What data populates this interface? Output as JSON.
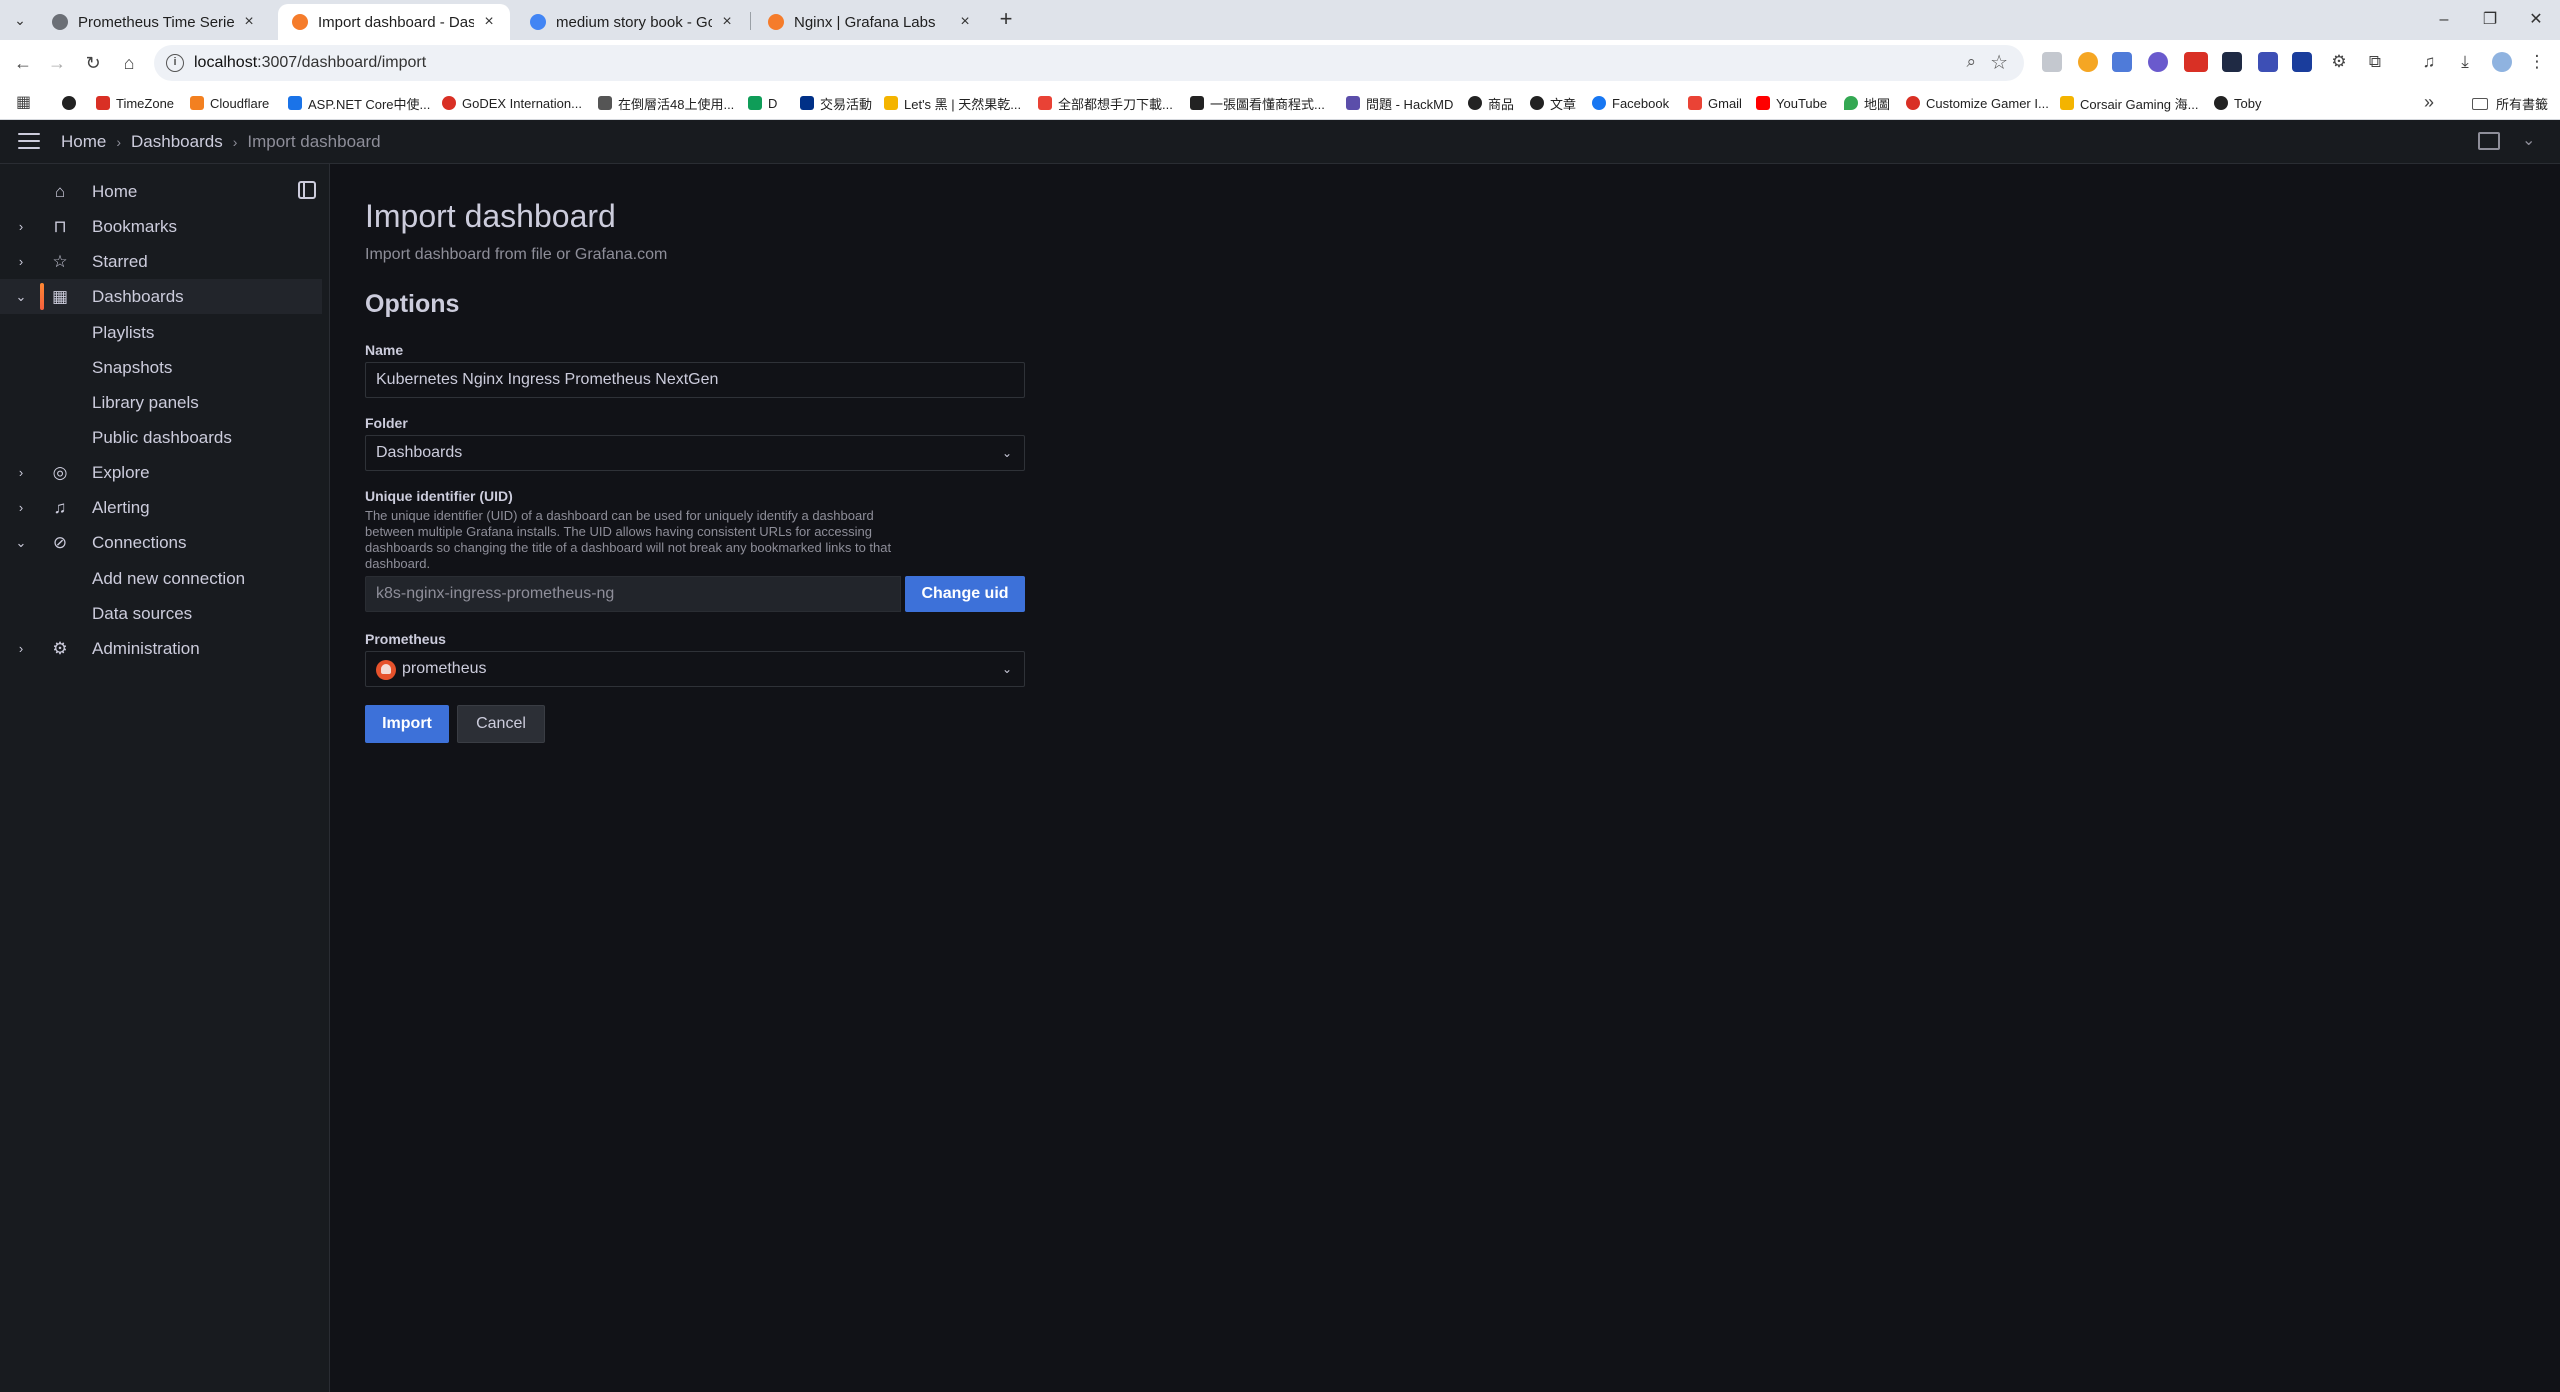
{
  "browser": {
    "tabs": [
      {
        "title": "Prometheus Time Series Colle",
        "color": "#6b6f76"
      },
      {
        "title": "Import dashboard - Dashboa",
        "color": "#f57c2b"
      },
      {
        "title": "medium story book - Google",
        "color": "#4285f4"
      },
      {
        "title": "Nginx | Grafana Labs",
        "color": "#f57c2b"
      }
    ],
    "url_host": "localhost",
    "url_path": ":3007/dashboard/import",
    "bookmarks": [
      {
        "label": "",
        "color": "#222222"
      },
      {
        "label": "TimeZone",
        "color": "#d93025"
      },
      {
        "label": "Cloudflare",
        "color": "#f38020"
      },
      {
        "label": "ASP.NET Core中使...",
        "color": "#1a73e8"
      },
      {
        "label": "GoDEX Internation...",
        "color": "#d93025"
      },
      {
        "label": "在倒層活48上使用...",
        "color": "#555555"
      },
      {
        "label": "D",
        "color": "#0f9d58"
      },
      {
        "label": "交易活動",
        "color": "#003087"
      },
      {
        "label": "Let's 黑 | 天然果乾...",
        "color": "#f4b400"
      },
      {
        "label": "全部都想手刀下載...",
        "color": "#e94235"
      },
      {
        "label": "一張圖看懂商程式...",
        "color": "#222222"
      },
      {
        "label": "問題 - HackMD",
        "color": "#5b4eaa"
      },
      {
        "label": "商品",
        "color": "#222222"
      },
      {
        "label": "文章",
        "color": "#222222"
      },
      {
        "label": "Facebook",
        "color": "#1877f2"
      },
      {
        "label": "Gmail",
        "color": "#ea4335"
      },
      {
        "label": "YouTube",
        "color": "#ff0000"
      },
      {
        "label": "地圖",
        "color": "#34a853"
      },
      {
        "label": "Customize Gamer I...",
        "color": "#d93025"
      },
      {
        "label": "Corsair Gaming 海...",
        "color": "#f4b400"
      },
      {
        "label": "Toby",
        "color": "#222222"
      }
    ],
    "bookmarks_folder": "所有書籤"
  },
  "topnav": {
    "crumbs": [
      "Home",
      "Dashboards",
      "Import dashboard"
    ]
  },
  "sidebar": {
    "items": [
      {
        "label": "Home",
        "icon": "home-icon",
        "glyph": "⌂",
        "chevron": ""
      },
      {
        "label": "Bookmarks",
        "icon": "bookmark-icon",
        "glyph": "🔖",
        "chevron": "›"
      },
      {
        "label": "Starred",
        "icon": "star-icon",
        "glyph": "☆",
        "chevron": "›"
      },
      {
        "label": "Dashboards",
        "icon": "apps-icon",
        "glyph": "▦",
        "chevron": "⌄"
      },
      {
        "label": "Explore",
        "icon": "compass-icon",
        "glyph": "◎",
        "chevron": "›"
      },
      {
        "label": "Alerting",
        "icon": "bell-icon",
        "glyph": "🔔",
        "chevron": "›"
      },
      {
        "label": "Connections",
        "icon": "connections-icon",
        "glyph": "⊘",
        "chevron": "⌄"
      },
      {
        "label": "Administration",
        "icon": "cog-icon",
        "glyph": "⚙",
        "chevron": "›"
      }
    ],
    "dashboards_sub": [
      "Playlists",
      "Snapshots",
      "Library panels",
      "Public dashboards"
    ],
    "connections_sub": [
      "Add new connection",
      "Data sources"
    ]
  },
  "main": {
    "title": "Import dashboard",
    "subtitle": "Import dashboard from file or Grafana.com",
    "section": "Options",
    "name_label": "Name",
    "name_value": "Kubernetes Nginx Ingress Prometheus NextGen",
    "folder_label": "Folder",
    "folder_value": "Dashboards",
    "uid_label": "Unique identifier (UID)",
    "uid_description": "The unique identifier (UID) of a dashboard can be used for uniquely identify a dashboard between multiple Grafana installs. The UID allows having consistent URLs for accessing dashboards so changing the title of a dashboard will not break any bookmarked links to that dashboard.",
    "uid_value": "k8s-nginx-ingress-prometheus-ng",
    "change_uid_label": "Change uid",
    "prometheus_label": "Prometheus",
    "prometheus_value": "prometheus",
    "import_label": "Import",
    "cancel_label": "Cancel"
  }
}
